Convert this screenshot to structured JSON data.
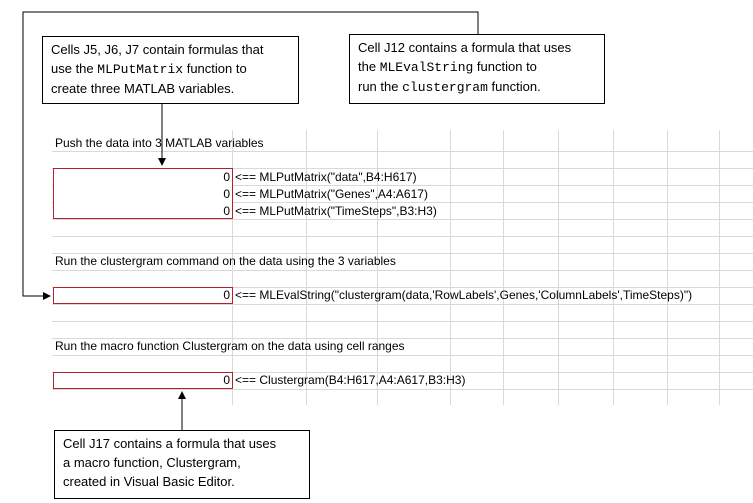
{
  "callout_top_left": {
    "parts_line1": "Cells J5, J6, J7 contain formulas that",
    "parts_line2_a": "use the ",
    "parts_line2_code": "MLPutMatrix",
    "parts_line2_b": " function to",
    "parts_line3": "create three MATLAB variables."
  },
  "callout_top_right": {
    "line1": "Cell J12 contains a formula that uses",
    "line2_a": "the ",
    "line2_code": "MLEvalString",
    "line2_b": " function to",
    "line3_a": "run the ",
    "line3_code": "clustergram",
    "line3_b": " function."
  },
  "callout_bottom": {
    "line1": "Cell J17 contains a formula that uses",
    "line2": "a macro function, Clustergram,",
    "line3": "created in Visual Basic Editor."
  },
  "sheet": {
    "section1_title": "Push the data into 3 MATLAB variables",
    "section1_rows": [
      {
        "value": "0",
        "formula": "<== MLPutMatrix(\"data\",B4:H617)"
      },
      {
        "value": "0",
        "formula": "<== MLPutMatrix(\"Genes\",A4:A617)"
      },
      {
        "value": "0",
        "formula": "<== MLPutMatrix(\"TimeSteps\",B3:H3)"
      }
    ],
    "section2_title": "Run the clustergram command on the data using the 3 variables",
    "section2_row": {
      "value": "0",
      "formula": "<== MLEvalString(\"clustergram(data,'RowLabels',Genes,'ColumnLabels',TimeSteps)\")"
    },
    "section3_title": "Run the macro function Clustergram on the data using cell ranges",
    "section3_row": {
      "value": "0",
      "formula": "<== Clustergram(B4:H617,A4:A617,B3:H3)"
    }
  },
  "colors": {
    "cell_border": "#b5212b",
    "gridline": "#d9d9d9"
  }
}
